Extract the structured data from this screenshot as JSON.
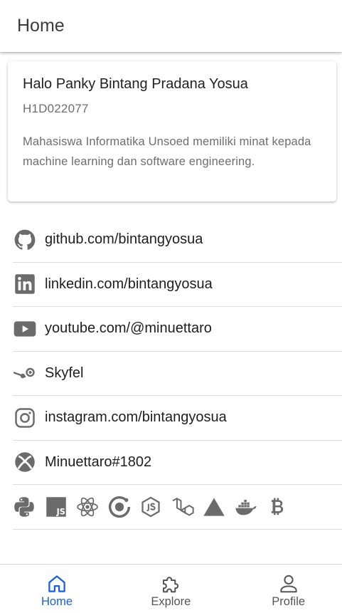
{
  "header": {
    "title": "Home"
  },
  "profile_card": {
    "name": "Halo Panky Bintang Pradana Yosua",
    "nim": "H1D022077",
    "bio": "Mahasiswa Informatika Unsoed memiliki minat kepada machine learning dan software engineering."
  },
  "links": [
    {
      "icon": "github-icon",
      "label": "github.com/bintangyosua"
    },
    {
      "icon": "linkedin-icon",
      "label": "linkedin.com/bintangyosua"
    },
    {
      "icon": "youtube-icon",
      "label": "youtube.com/@minuettaro"
    },
    {
      "icon": "steam-icon",
      "label": "Skyfel"
    },
    {
      "icon": "instagram-icon",
      "label": "instagram.com/bintangyosua"
    },
    {
      "icon": "xbox-icon",
      "label": "Minuettaro#1802"
    }
  ],
  "tech_icons": [
    "python-icon",
    "javascript-icon",
    "react-icon",
    "ionic-icon",
    "nodejs-icon",
    "laravel-icon",
    "vercel-icon",
    "docker-icon",
    "bitcoin-icon"
  ],
  "bottom_nav": [
    {
      "label": "Home",
      "icon": "home-icon",
      "active": true
    },
    {
      "label": "Explore",
      "icon": "puzzle-icon",
      "active": false
    },
    {
      "label": "Profile",
      "icon": "person-icon",
      "active": false
    }
  ],
  "colors": {
    "accent": "#1a5fd6",
    "icon_gray": "#6b6b6b",
    "divider": "#dcdcdc"
  }
}
